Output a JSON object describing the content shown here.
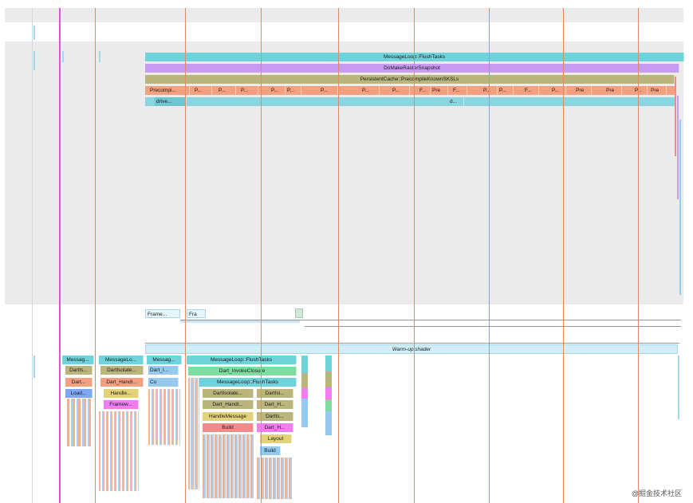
{
  "gpu_track": {
    "row1": {
      "label": "MessageLoop::FlushTasks",
      "color": "#6fd3dc"
    },
    "row2": {
      "label": "DoMakeRasterSnapshot",
      "color": "#c79bf2"
    },
    "row3": {
      "label": "PersistentCache::PrecompileKnownSKSLs",
      "color": "#b9b57b"
    },
    "row4_color": "#f2a07f",
    "row4_labels": [
      "Precompi...",
      "P...",
      "P...",
      "P...",
      "P...",
      "P...",
      "P...",
      "P...",
      "P...",
      "F...",
      "Pre",
      "F...",
      "P...",
      "P...",
      "F...",
      "P...",
      "Pre",
      "Pre",
      "P...",
      "Pre"
    ],
    "row5_color": "#8ad6e0",
    "row5_labels": [
      "drive...",
      "d..."
    ]
  },
  "frames": {
    "frame_label": "Frame...",
    "fra_label": "Fra",
    "warmup_label": "Warm-up shader",
    "warmup_color": "#cfeef8"
  },
  "ui_track": {
    "col1": {
      "row1": "Messag...",
      "row2": "DartIs...",
      "row3": "Dart...",
      "row4": "Load..."
    },
    "col2": {
      "row1": "MessageLo...",
      "row2": "DartIsolate...",
      "row3": "Dart_Handl...",
      "row4": "Handle...",
      "row5": "Framew..."
    },
    "col3": {
      "row1": "Messag...",
      "row2": "Dart_I...",
      "row3": "Co"
    },
    "col4": {
      "row1": "MessageLoop::FlushTasks",
      "row2": "Dart_InvokeClosure",
      "row3": "MessageLoop::FlushTasks",
      "row4a": "DartIsolate...",
      "row4b": "DartIsi...",
      "row5a": "Dart_Handl...",
      "row5b": "Dart_H...",
      "row6a": "HandleMessage",
      "row6b": "DartIs...",
      "row7a": "Build",
      "row7b": "Dart_H...",
      "row8": "Layout",
      "row9": "Build"
    },
    "colors": {
      "teal": "#6fd3dc",
      "olive": "#b9b57b",
      "orange": "#f2a07f",
      "magenta": "#f07ef0",
      "blue": "#7fa6f2",
      "green": "#7fdca0",
      "salmon": "#f28a8a",
      "yellow": "#e4d27a",
      "pink": "#f5a6c9",
      "lightblue": "#96c9f0",
      "purple": "#c79bf2"
    }
  },
  "watermark": "@掘金技术社区"
}
